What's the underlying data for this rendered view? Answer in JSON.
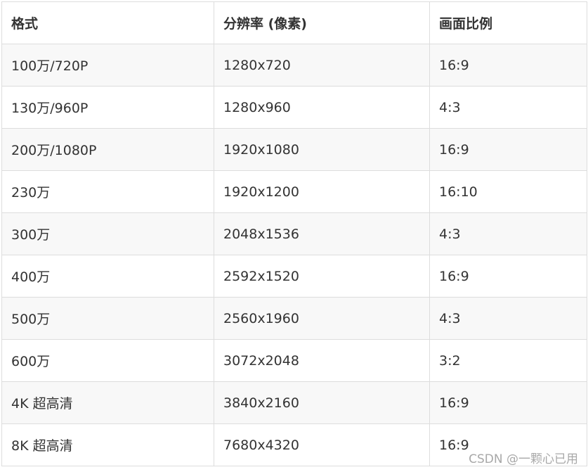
{
  "table": {
    "headers": [
      "格式",
      "分辨率 (像素)",
      "画面比例"
    ],
    "rows": [
      [
        "100万/720P",
        "1280x720",
        "16:9"
      ],
      [
        "130万/960P",
        "1280x960",
        "4:3"
      ],
      [
        "200万/1080P",
        "1920x1080",
        "16:9"
      ],
      [
        "230万",
        "1920x1200",
        "16:10"
      ],
      [
        "300万",
        "2048x1536",
        "4:3"
      ],
      [
        "400万",
        "2592x1520",
        "16:9"
      ],
      [
        "500万",
        "2560x1960",
        "4:3"
      ],
      [
        "600万",
        "3072x2048",
        "3:2"
      ],
      [
        "4K 超高清",
        "3840x2160",
        "16:9"
      ],
      [
        "8K 超高清",
        "7680x4320",
        "16:9"
      ]
    ]
  },
  "watermark": "CSDN @一颗心已用"
}
